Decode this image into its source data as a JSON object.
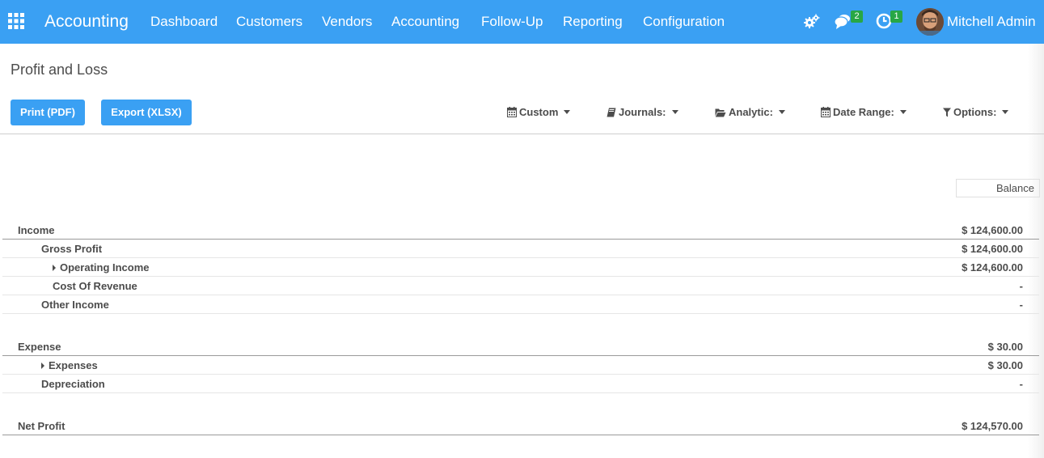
{
  "navbar": {
    "brand": "Accounting",
    "menu": [
      "Dashboard",
      "Customers",
      "Vendors",
      "Accounting",
      "Follow-Up",
      "Reporting",
      "Configuration"
    ],
    "messages_badge": "2",
    "activities_badge": "1",
    "user_name": "Mitchell Admin"
  },
  "control_panel": {
    "title": "Profit and Loss",
    "print_label": "Print (PDF)",
    "export_label": "Export (XLSX)",
    "filters": {
      "custom": "Custom",
      "journals": "Journals:",
      "analytic": "Analytic:",
      "date_range": "Date Range:",
      "options": "Options:"
    }
  },
  "report": {
    "column_header": "Balance",
    "rows": [
      {
        "label": "Income",
        "value": "$ 124,600.00"
      },
      {
        "label": "Gross Profit",
        "value": "$ 124,600.00"
      },
      {
        "label": "Operating Income",
        "value": "$ 124,600.00"
      },
      {
        "label": "Cost Of Revenue",
        "value": "-"
      },
      {
        "label": "Other Income",
        "value": "-"
      },
      {
        "label": "Expense",
        "value": "$ 30.00"
      },
      {
        "label": "Expenses",
        "value": "$ 30.00"
      },
      {
        "label": "Depreciation",
        "value": "-"
      },
      {
        "label": "Net Profit",
        "value": "$ 124,570.00"
      }
    ]
  },
  "colors": {
    "navbar": "#3aa0f3",
    "button": "#3aa0f3",
    "badge": "#28a745",
    "text": "#4c4c4c"
  },
  "icons": [
    "apps-grid-icon",
    "debug-gears-icon",
    "chat-bubbles-icon",
    "clock-icon",
    "calendar-icon",
    "book-icon",
    "folder-open-icon",
    "filter-funnel-icon",
    "caret-down-icon",
    "caret-right-icon"
  ]
}
